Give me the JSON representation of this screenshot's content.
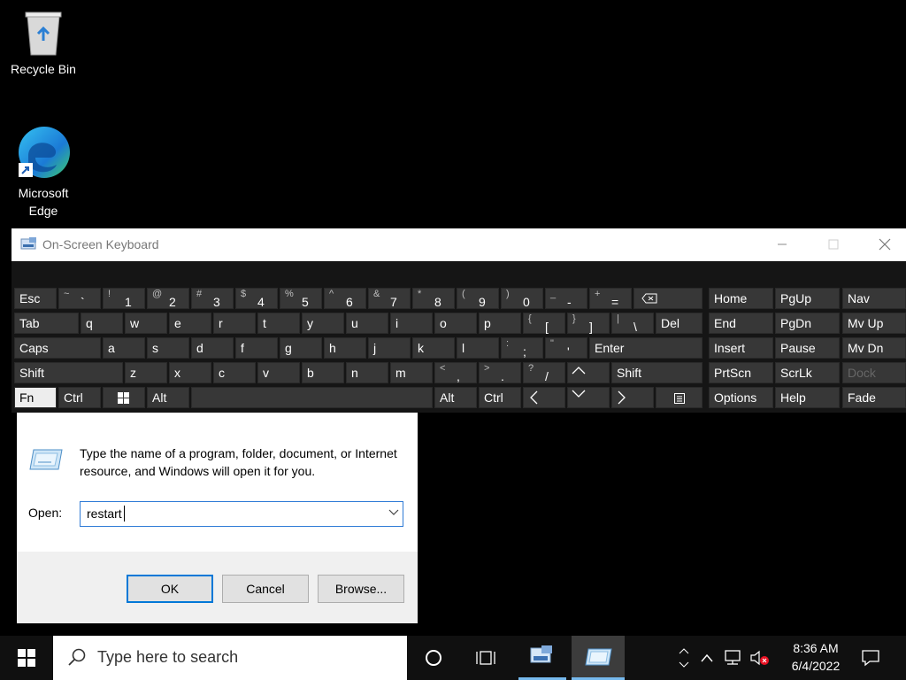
{
  "desktop": {
    "icons": [
      {
        "label": "Recycle Bin"
      },
      {
        "label": "Microsoft Edge"
      }
    ]
  },
  "osk": {
    "title": "On-Screen Keyboard",
    "rows": {
      "r1": [
        {
          "label": "Esc"
        },
        {
          "shift": "~",
          "main": "`"
        },
        {
          "shift": "!",
          "main": "1"
        },
        {
          "shift": "@",
          "main": "2"
        },
        {
          "shift": "#",
          "main": "3"
        },
        {
          "shift": "$",
          "main": "4"
        },
        {
          "shift": "%",
          "main": "5"
        },
        {
          "shift": "^",
          "main": "6"
        },
        {
          "shift": "&",
          "main": "7"
        },
        {
          "shift": "*",
          "main": "8"
        },
        {
          "shift": "(",
          "main": "9"
        },
        {
          "shift": ")",
          "main": "0"
        },
        {
          "shift": "_",
          "main": "-"
        },
        {
          "shift": "+",
          "main": "="
        },
        {
          "label": "Home"
        },
        {
          "label": "PgUp"
        },
        {
          "label": "Nav"
        }
      ],
      "r2": [
        {
          "label": "Tab"
        },
        {
          "label": "q"
        },
        {
          "label": "w"
        },
        {
          "label": "e"
        },
        {
          "label": "r"
        },
        {
          "label": "t"
        },
        {
          "label": "y"
        },
        {
          "label": "u"
        },
        {
          "label": "i"
        },
        {
          "label": "o"
        },
        {
          "label": "p"
        },
        {
          "shift": "{",
          "main": "["
        },
        {
          "shift": "}",
          "main": "]"
        },
        {
          "shift": "|",
          "main": "\\"
        },
        {
          "label": "Del"
        },
        {
          "label": "End"
        },
        {
          "label": "PgDn"
        },
        {
          "label": "Mv Up"
        }
      ],
      "r3": [
        {
          "label": "Caps"
        },
        {
          "label": "a"
        },
        {
          "label": "s"
        },
        {
          "label": "d"
        },
        {
          "label": "f"
        },
        {
          "label": "g"
        },
        {
          "label": "h"
        },
        {
          "label": "j"
        },
        {
          "label": "k"
        },
        {
          "label": "l"
        },
        {
          "shift": ":",
          "main": ";"
        },
        {
          "shift": "\"",
          "main": "'"
        },
        {
          "label": "Enter"
        },
        {
          "label": "Insert"
        },
        {
          "label": "Pause"
        },
        {
          "label": "Mv Dn"
        }
      ],
      "r4": [
        {
          "label": "Shift"
        },
        {
          "label": "z"
        },
        {
          "label": "x"
        },
        {
          "label": "c"
        },
        {
          "label": "v"
        },
        {
          "label": "b"
        },
        {
          "label": "n"
        },
        {
          "label": "m"
        },
        {
          "shift": "<",
          "main": ","
        },
        {
          "shift": ">",
          "main": "."
        },
        {
          "shift": "?",
          "main": "/"
        },
        {
          "label": "Shift"
        },
        {
          "label": "PrtScn"
        },
        {
          "label": "ScrLk"
        },
        {
          "label": "Dock"
        }
      ],
      "r5": [
        {
          "label": "Fn"
        },
        {
          "label": "Ctrl"
        },
        {
          "label": "Alt"
        },
        {
          "label": "Alt"
        },
        {
          "label": "Ctrl"
        },
        {
          "label": "Options"
        },
        {
          "label": "Help"
        },
        {
          "label": "Fade"
        }
      ]
    }
  },
  "run": {
    "description": "Type the name of a program, folder, document, or Internet resource, and Windows will open it for you.",
    "open_label": "Open:",
    "open_value": "restart",
    "ok": "OK",
    "cancel": "Cancel",
    "browse": "Browse..."
  },
  "taskbar": {
    "search_placeholder": "Type here to search",
    "time": "8:36 AM",
    "date": "6/4/2022"
  }
}
